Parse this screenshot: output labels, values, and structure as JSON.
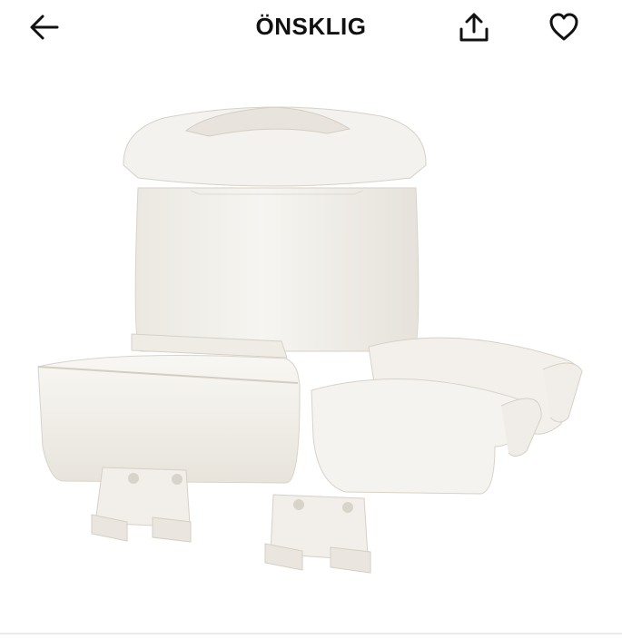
{
  "header": {
    "title": "ÖNSKLIG",
    "back_icon": "arrow-left-icon",
    "share_icon": "share-icon",
    "favorite_icon": "heart-icon"
  },
  "product": {
    "image_icon": "product-photo"
  },
  "colors": {
    "text": "#111111",
    "background": "#ffffff",
    "product": "#f3f1ec"
  }
}
